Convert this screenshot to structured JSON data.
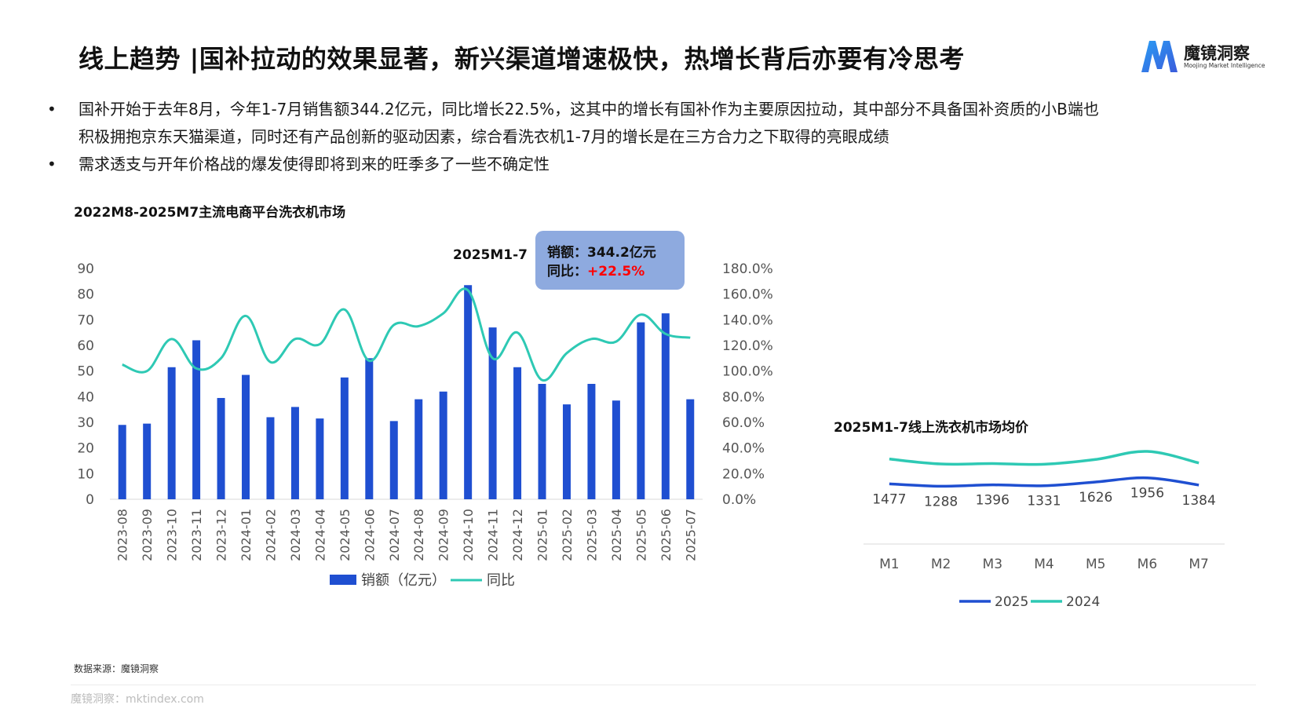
{
  "header": {
    "title": "线上趋势 |国补拉动的效果显著，新兴渠道增速极快，热增长背后亦要有冷思考",
    "logo_text": "魔镜洞察",
    "logo_subtitle": "Moojing Market Intelligence",
    "logo_icon": "m-logo-icon"
  },
  "bullets": [
    {
      "marker": "•",
      "lines": [
        "国补开始于去年8月，今年1-7月销售额344.2亿元，同比增长22.5%，这其中的增长有国补作为主要原因拉动，其中部分不具备国补资质的小B端也",
        "积极拥抱京东天猫渠道，同时还有产品创新的驱动因素，综合看洗衣机1-7月的增长是在三方合力之下取得的亮眼成绩"
      ]
    },
    {
      "marker": "•",
      "lines": [
        "需求透支与开年价格战的爆发使得即将到来的旺季多了一些不确定性"
      ]
    }
  ],
  "callout": {
    "period": "2025M1-7",
    "sales_label": "销额：344.2亿元",
    "yoy_label": "同比：",
    "yoy_value": "+22.5%",
    "box_color": "#8eaadf",
    "yoy_color": "#ff0000"
  },
  "chart_data": [
    {
      "type": "bar",
      "title": "2022M8-2025M7主流电商平台洗衣机市场",
      "categories": [
        "2023-08",
        "2023-09",
        "2023-10",
        "2023-11",
        "2023-12",
        "2024-01",
        "2024-02",
        "2024-03",
        "2024-04",
        "2024-05",
        "2024-06",
        "2024-07",
        "2024-08",
        "2024-09",
        "2024-10",
        "2024-11",
        "2024-12",
        "2025-01",
        "2025-02",
        "2025-03",
        "2025-04",
        "2025-05",
        "2025-06",
        "2025-07"
      ],
      "series": [
        {
          "name": "销额（亿元）",
          "type": "bar",
          "axis": "left",
          "color": "#1f4fd1",
          "values": [
            29,
            29.5,
            51.5,
            62,
            39.5,
            48.5,
            32,
            36,
            31.5,
            47.5,
            55,
            30.5,
            39,
            42,
            83.5,
            67,
            51.5,
            45,
            37,
            45,
            38.5,
            69,
            72.5,
            39
          ]
        },
        {
          "name": "同比",
          "type": "line",
          "axis": "right",
          "color": "#2ec9b4",
          "values": [
            105,
            100,
            125,
            102,
            110,
            143,
            107,
            125,
            121,
            148,
            108,
            136,
            135,
            145,
            163,
            110,
            130,
            93,
            114,
            125,
            123,
            144,
            129,
            126
          ]
        }
      ],
      "ylim_left": [
        0,
        90
      ],
      "yticks_left": [
        "0",
        "10",
        "20",
        "30",
        "40",
        "50",
        "60",
        "70",
        "80",
        "90"
      ],
      "ylim_right": [
        0,
        180
      ],
      "yticks_right": [
        "0.0%",
        "20.0%",
        "40.0%",
        "60.0%",
        "80.0%",
        "100.0%",
        "120.0%",
        "140.0%",
        "160.0%",
        "180.0%"
      ],
      "grid": false,
      "legend": "bottom"
    },
    {
      "type": "line",
      "title": "2025M1-7线上洗衣机市场均价",
      "categories": [
        "M1",
        "M2",
        "M3",
        "M4",
        "M5",
        "M6",
        "M7"
      ],
      "series": [
        {
          "name": "2025",
          "color": "#1f4fd1",
          "values": [
            1477,
            1288,
            1396,
            1331,
            1626,
            1956,
            1384
          ],
          "labels": [
            "1477",
            "1288",
            "1396",
            "1331",
            "1626",
            "1956",
            "1384"
          ]
        },
        {
          "name": "2024",
          "color": "#2ec9b4",
          "values": [
            3450,
            3060,
            3090,
            3040,
            3420,
            4060,
            3140
          ]
        }
      ],
      "grid": false,
      "legend": "bottom"
    }
  ],
  "source": "数据来源：魔镜洞察",
  "footer": "魔镜洞察：mktindex.com"
}
